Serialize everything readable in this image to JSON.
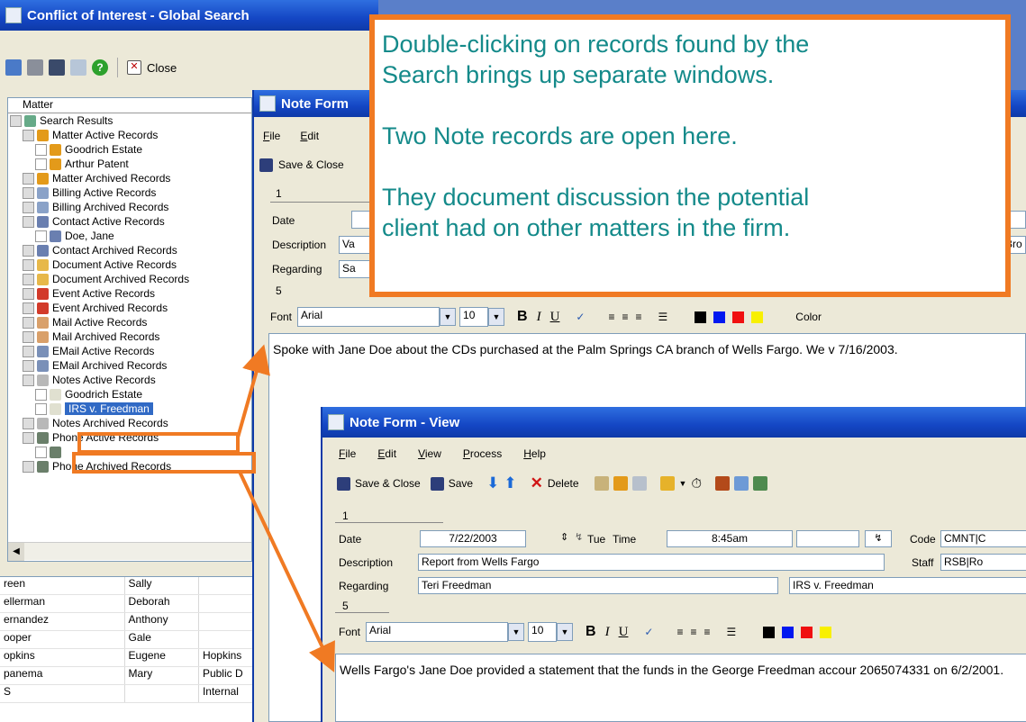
{
  "main_window": {
    "title": "Conflict of Interest - Global Search",
    "close_label": "Close",
    "tree_header": "Matter",
    "tree": [
      {
        "label": "Search Results",
        "indent": 0
      },
      {
        "label": "Matter Active Records",
        "indent": 1
      },
      {
        "label": "Goodrich Estate",
        "indent": 2
      },
      {
        "label": "Arthur Patent",
        "indent": 2
      },
      {
        "label": "Matter Archived Records",
        "indent": 1
      },
      {
        "label": "Billing Active Records",
        "indent": 1
      },
      {
        "label": "Billing Archived Records",
        "indent": 1
      },
      {
        "label": "Contact Active Records",
        "indent": 1
      },
      {
        "label": "Doe, Jane",
        "indent": 2
      },
      {
        "label": "Contact Archived Records",
        "indent": 1
      },
      {
        "label": "Document Active Records",
        "indent": 1
      },
      {
        "label": "Document Archived Records",
        "indent": 1
      },
      {
        "label": "Event Active Records",
        "indent": 1
      },
      {
        "label": "Event Archived Records",
        "indent": 1
      },
      {
        "label": "Mail Active Records",
        "indent": 1
      },
      {
        "label": "Mail Archived Records",
        "indent": 1
      },
      {
        "label": "EMail Active Records",
        "indent": 1
      },
      {
        "label": "EMail Archived Records",
        "indent": 1
      },
      {
        "label": "Notes Active Records",
        "indent": 1
      },
      {
        "label": "Goodrich Estate",
        "indent": 2
      },
      {
        "label": "IRS v. Freedman",
        "indent": 2
      },
      {
        "label": "Notes Archived Records",
        "indent": 1
      },
      {
        "label": "Phone Active Records",
        "indent": 1
      },
      {
        "label": "",
        "indent": 2
      },
      {
        "label": "Phone Archived Records",
        "indent": 1
      }
    ],
    "grid_rows": [
      [
        "reen",
        "Sally",
        ""
      ],
      [
        "ellerman",
        "Deborah",
        ""
      ],
      [
        "ernandez",
        "Anthony",
        ""
      ],
      [
        "ooper",
        "Gale",
        ""
      ],
      [
        "opkins",
        "Eugene",
        "Hopkins"
      ],
      [
        "panema",
        "Mary",
        "Public D"
      ],
      [
        "S",
        "",
        "Internal"
      ]
    ]
  },
  "note_back": {
    "title": "Note Form",
    "menu": [
      "File",
      "Edit"
    ],
    "save_close": "Save & Close",
    "section1": "1",
    "date_label": "Date",
    "description_label": "Description",
    "description_value": "Va",
    "regarding_label": "Regarding",
    "regarding_value": "Sa",
    "section5": "5",
    "font_label": "Font",
    "font_value": "Arial",
    "size_value": "10",
    "color_label": "Color",
    "right_fragment_1": "s",
    "right_fragment_2": "Bro",
    "body_text": "Spoke with Jane Doe about the CDs purchased at the Palm Springs CA branch of Wells Fargo. We v 7/16/2003."
  },
  "note_front": {
    "title": "Note Form - View",
    "menu": [
      "File",
      "Edit",
      "View",
      "Process",
      "Help"
    ],
    "save_close": "Save & Close",
    "save": "Save",
    "delete": "Delete",
    "section1": "1",
    "date_label": "Date",
    "date_value": "7/22/2003",
    "day_value": "Tue",
    "time_label": "Time",
    "time_value": "8:45am",
    "code_label": "Code",
    "code_value": "CMNT|C",
    "description_label": "Description",
    "description_value": "Report from Wells Fargo",
    "staff_label": "Staff",
    "staff_value": "RSB|Ro",
    "regarding_label": "Regarding",
    "regarding_value": "Teri Freedman",
    "matter_value": "IRS v. Freedman",
    "section5": "5",
    "font_label": "Font",
    "font_value": "Arial",
    "size_value": "10",
    "body_text": "Wells Fargo's Jane Doe provided a statement that the funds in the George Freedman accour 2065074331 on 6/2/2001."
  },
  "callout": {
    "line1": "Double-clicking on records found by the",
    "line2": "Search brings up separate windows.",
    "line3": "Two Note records are open here.",
    "line4": "They document discussion the potential",
    "line5": "client had on other matters in the firm."
  },
  "colors": {
    "accent": "#f07a23",
    "callout_text": "#148a8a",
    "titlebar": "#1446c4",
    "selection": "#316ac5"
  }
}
